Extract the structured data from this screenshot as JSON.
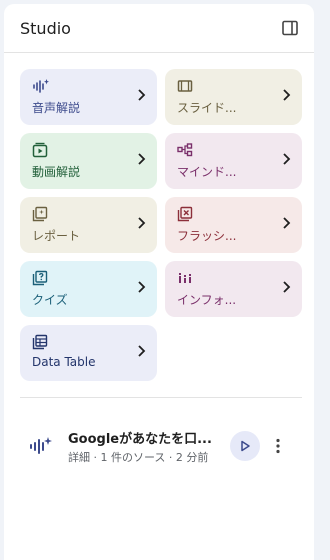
{
  "panel": {
    "title": "Studio"
  },
  "tiles": [
    {
      "label": "音声解説",
      "icon": "audio-waveform-icon"
    },
    {
      "label": "スライド...",
      "icon": "slides-icon"
    },
    {
      "label": "動画解説",
      "icon": "video-icon"
    },
    {
      "label": "マインド...",
      "icon": "mindmap-icon"
    },
    {
      "label": "レポート",
      "icon": "report-icon"
    },
    {
      "label": "フラッシ...",
      "icon": "flashcard-icon"
    },
    {
      "label": "クイズ",
      "icon": "quiz-icon"
    },
    {
      "label": "インフォ...",
      "icon": "infographic-icon"
    },
    {
      "label": "Data Table",
      "icon": "table-icon"
    }
  ],
  "note": {
    "title": "Googleがあなたを口...",
    "meta": "詳細 · 1 件のソース · 2 分前",
    "icon": "audio-waveform-icon"
  }
}
